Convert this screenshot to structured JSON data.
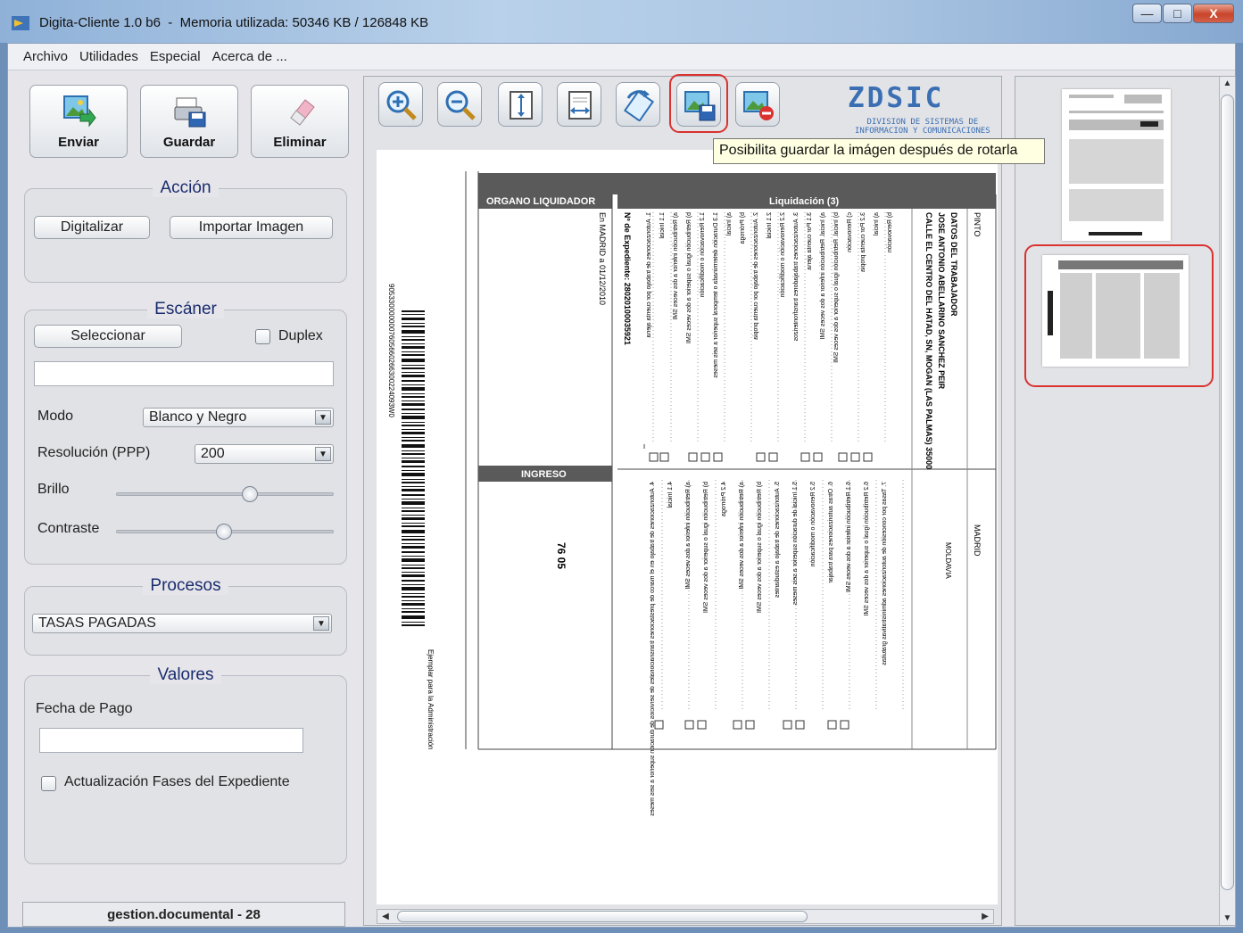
{
  "window": {
    "app_name": "Digita-Cliente 1.0 b6",
    "separator": "-",
    "memory_label": "Memoria utilizada: 50346 KB / 126848 KB",
    "minimize": "—",
    "maximize": "□",
    "close": "X"
  },
  "menu": [
    "Archivo",
    "Utilidades",
    "Especial",
    "Acerca de ..."
  ],
  "actions": {
    "send": "Enviar",
    "save": "Guardar",
    "delete": "Eliminar"
  },
  "accion": {
    "title": "Acción",
    "digitize": "Digitalizar",
    "import": "Importar Imagen"
  },
  "scanner": {
    "title": "Escáner",
    "select": "Seleccionar",
    "duplex": "Duplex",
    "device": "",
    "mode_label": "Modo",
    "mode_value": "Blanco y Negro",
    "resolution_label": "Resolución (PPP)",
    "resolution_value": "200",
    "brightness_label": "Brillo",
    "brightness": 0.62,
    "contrast_label": "Contraste",
    "contrast": 0.49
  },
  "procesos": {
    "title": "Procesos",
    "value": "TASAS PAGADAS"
  },
  "valores": {
    "title": "Valores",
    "date_label": "Fecha de Pago",
    "date_value": "",
    "update_label": "Actualización Fases del Expediente"
  },
  "status": "gestion.documental - 28",
  "toolbar": {
    "tooltip": "Posibilita guardar la imágen después de rotarla",
    "logo_big": "ZDSIC",
    "logo_small_1": "DIVISION DE SISTEMAS DE",
    "logo_small_2": "INFORMACION Y COMUNICACIONES"
  },
  "document": {
    "organ": "ORGANO LIQUIDADOR",
    "liquidacion": "Liquidación (3)",
    "ingreso": "INGRESO",
    "worker_heading": "DATOS DEL TRABAJADOR",
    "worker_name": "JOSE ANTONIO ABELLARINO SANCHEZ PEIR",
    "worker_address": "CALLE EL CENTRO DEL HATAD, SN, MOGAN (LAS PALMAS) 35000",
    "municipio": "PINTO",
    "provincia": "MADRID",
    "nacionalidad": "MOLDAVIA",
    "place_date": "En MADRID a 01/12/2010",
    "expediente": "Nº de Expediente: 28020100035921",
    "importe": "76 05",
    "barcode_number": "9053300000007605660266300224093W0",
    "ejemplar": "Ejemplar para la Administración",
    "lines": [
      "1. Autorizaciones de trabajo por cuenta ajena",
      "1.1 Inicial",
      "a) Retribución inferior a dos veces SMI",
      "b) Retribución igual o superior a dos veces SMI",
      "1.2 Renovación o modificación",
      "1.3 Duración determinada o temporal superior a seis meses",
      "a) Inicial",
      "b) Prórroga",
      "2. Autorizaciones de trabajo por cuenta propia",
      "2.1 Inicial",
      "2.2 Renovación o modificación",
      "3. Autorizaciones trabajadores transfronterizos",
      "3.1 Por cuenta ajena",
      "a) Inicial. Retribución inferior a dos veces SMI",
      "b) Inicial. Retribución igual o superior a dos veces SMI",
      "c) Renovación",
      "3.2 Por cuenta propia",
      "a) Inicial",
      "b) Renovación"
    ],
    "lines2": [
      "4. Autorizaciones de trabajo en el marco de prestaciones transnacionales de servicios de duración superior a seis meses",
      "4.1 Inicial",
      "a) Retribución inferior a dos veces SMI",
      "b) Retribución igual o superior a dos veces SMI",
      "4.2 Prórroga",
      "a) Retribución inferior a dos veces SMI",
      "b) Retribución igual o superior a dos veces SMI",
      "5. Autorizaciones de trabajo a estudiantes",
      "5.1 Inicial de duración superior a seis meses",
      "5.2 Renovación o modificación",
      "6. Otras autorizaciones para trabajar",
      "6.1 Retribución inferior a dos veces SMI",
      "6.2 Retribución igual o superior a dos veces SMI",
      "7. Tasas por concesión de autorizaciones administrativas gratuitas"
    ]
  },
  "colors": {
    "accent_red": "#d9322f",
    "title_blue": "#1a2c6e",
    "tooltip_bg": "#ffffe1"
  }
}
